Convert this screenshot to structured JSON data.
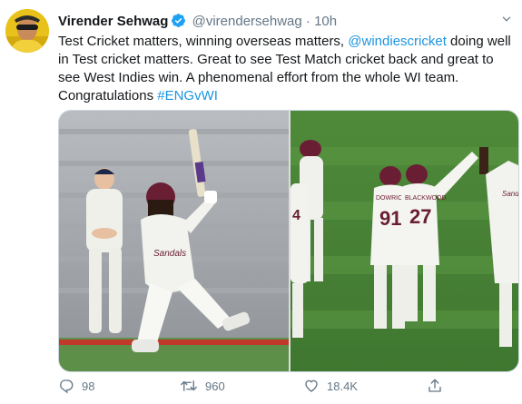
{
  "tweet": {
    "author_name": "Virender Sehwag",
    "handle": "@virendersehwag",
    "separator": "·",
    "time": "10h",
    "text_before_mention": "Test Cricket matters, winning overseas matters, ",
    "mention": "@windiescricket",
    "text_after_mention": " doing well in Test cricket matters. Great to see Test Match cricket back and great to see West Indies win. A phenomenal effort from the whole WI team. Congratulations ",
    "hashtag": "#ENGvWI",
    "media_left": {
      "jersey_text": "Sandals"
    },
    "media_right": {
      "jersey_numbers": [
        "4",
        "91",
        "27"
      ],
      "player_names": [
        "DOWRICH",
        "BLACKWOOD"
      ],
      "jersey_text": "Sandals"
    },
    "actions": {
      "replies": "98",
      "retweets": "960",
      "likes": "18.4K"
    },
    "icons": {
      "verified": "verified-badge-icon",
      "caret": "chevron-down-icon",
      "reply": "reply-icon",
      "retweet": "retweet-icon",
      "like": "heart-icon",
      "share": "share-icon"
    },
    "colors": {
      "link": "#1b95e0",
      "muted": "#657786",
      "text": "#14171a",
      "verified": "#1da1f2"
    }
  }
}
